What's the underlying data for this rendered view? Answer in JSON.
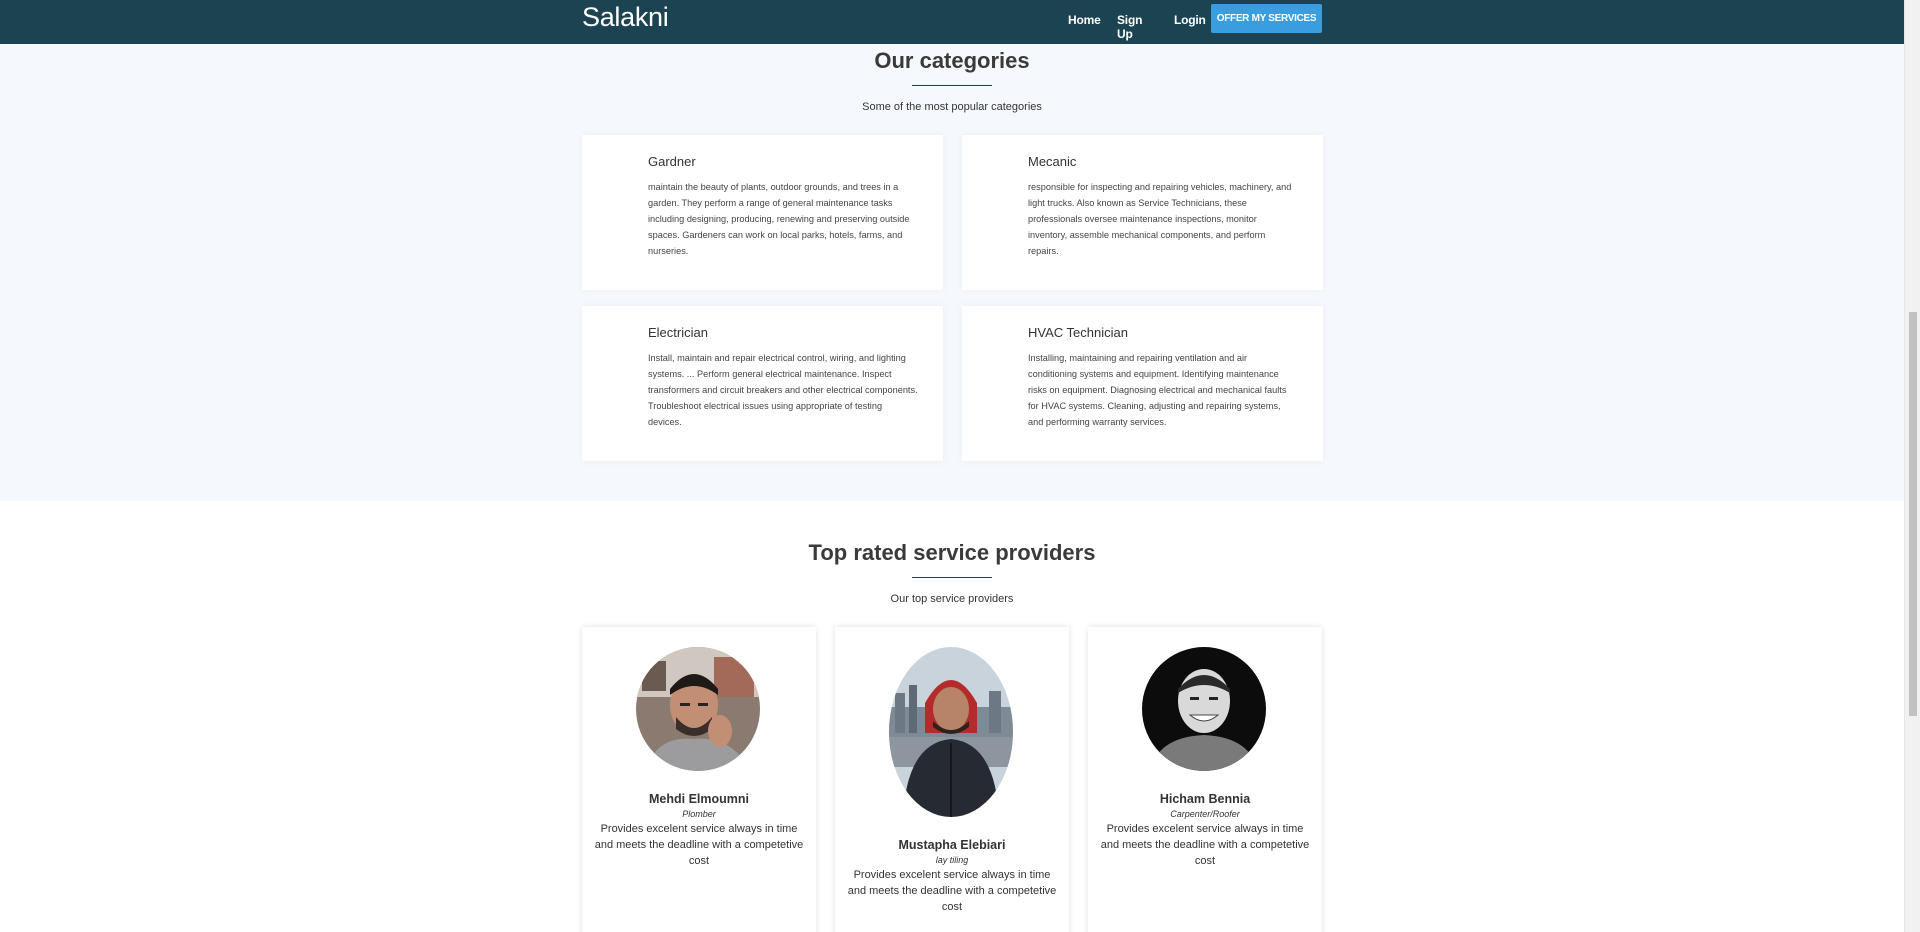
{
  "navbar": {
    "brand": "Salakni",
    "links": {
      "home": "Home",
      "signup": "Sign Up",
      "login": "Login"
    },
    "offer_button": "OFFER MY SERVICES"
  },
  "categories": {
    "title": "Our categories",
    "subtitle": "Some of the most popular categories",
    "items": [
      {
        "name": "Gardner",
        "description": "maintain the beauty of plants, outdoor grounds, and trees in a garden. They perform a range of general maintenance tasks including designing, producing, renewing and preserving outside spaces. Gardeners can work on local parks, hotels, farms, and nurseries."
      },
      {
        "name": "Mecanic",
        "description": "responsible for inspecting and repairing vehicles, machinery, and light trucks. Also known as Service Technicians, these professionals oversee maintenance inspections, monitor inventory, assemble mechanical components, and perform repairs."
      },
      {
        "name": "Electrician",
        "description": "Install, maintain and repair electrical control, wiring, and lighting systems. ... Perform general electrical maintenance. Inspect transformers and circuit breakers and other electrical components. Troubleshoot electrical issues using appropriate of testing devices."
      },
      {
        "name": "HVAC Technician",
        "description": "Installing, maintaining and repairing ventilation and air conditioning systems and equipment. Identifying maintenance risks on equipment. Diagnosing electrical and mechanical faults for HVAC systems. Cleaning, adjusting and repairing systems, and performing warranty services."
      }
    ]
  },
  "providers": {
    "title": "Top rated service providers",
    "subtitle": "Our top service providers",
    "items": [
      {
        "name": "Mehdi Elmoumni",
        "role": "Plomber",
        "description": "Provides excelent service always in time and meets the deadline with a competetive cost"
      },
      {
        "name": "Mustapha Elebiari",
        "role": "lay tiling",
        "description": "Provides excelent service always in time and meets the deadline with a competetive cost"
      },
      {
        "name": "Hicham Bennia",
        "role": "Carpenter/Roofer",
        "description": "Provides excelent service always in time and meets the deadline with a competetive cost"
      }
    ]
  },
  "colors": {
    "navbar": "#1b4352",
    "offer_button": "#3a9ede",
    "section_bg": "#f5f9fd"
  }
}
